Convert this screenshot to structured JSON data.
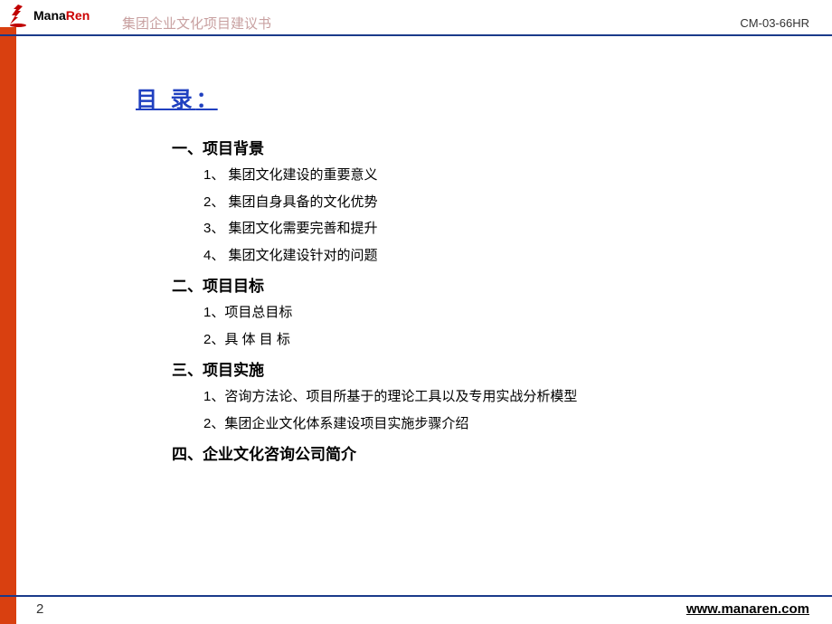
{
  "header": {
    "logo_text_1": "Mana",
    "logo_text_2": "Ren",
    "title": "集团企业文化项目建议书",
    "code": "CM-03-66HR"
  },
  "toc": {
    "title": "目 录",
    "colon": "：",
    "sections": [
      {
        "title": "一、项目背景",
        "items": [
          "1、 集团文化建设的重要意义",
          "2、 集团自身具备的文化优势",
          "3、 集团文化需要完善和提升",
          "4、 集团文化建设针对的问题"
        ]
      },
      {
        "title": "二、项目目标",
        "items": [
          "1、项目总目标",
          "2、具 体 目 标"
        ]
      },
      {
        "title": "三、项目实施",
        "items": [
          "1、咨询方法论、项目所基于的理论工具以及专用实战分析模型",
          "2、集团企业文化体系建设项目实施步骤介绍"
        ]
      },
      {
        "title": "四、企业文化咨询公司简介",
        "items": []
      }
    ]
  },
  "footer": {
    "page": "2",
    "url": "www.manaren.com"
  }
}
